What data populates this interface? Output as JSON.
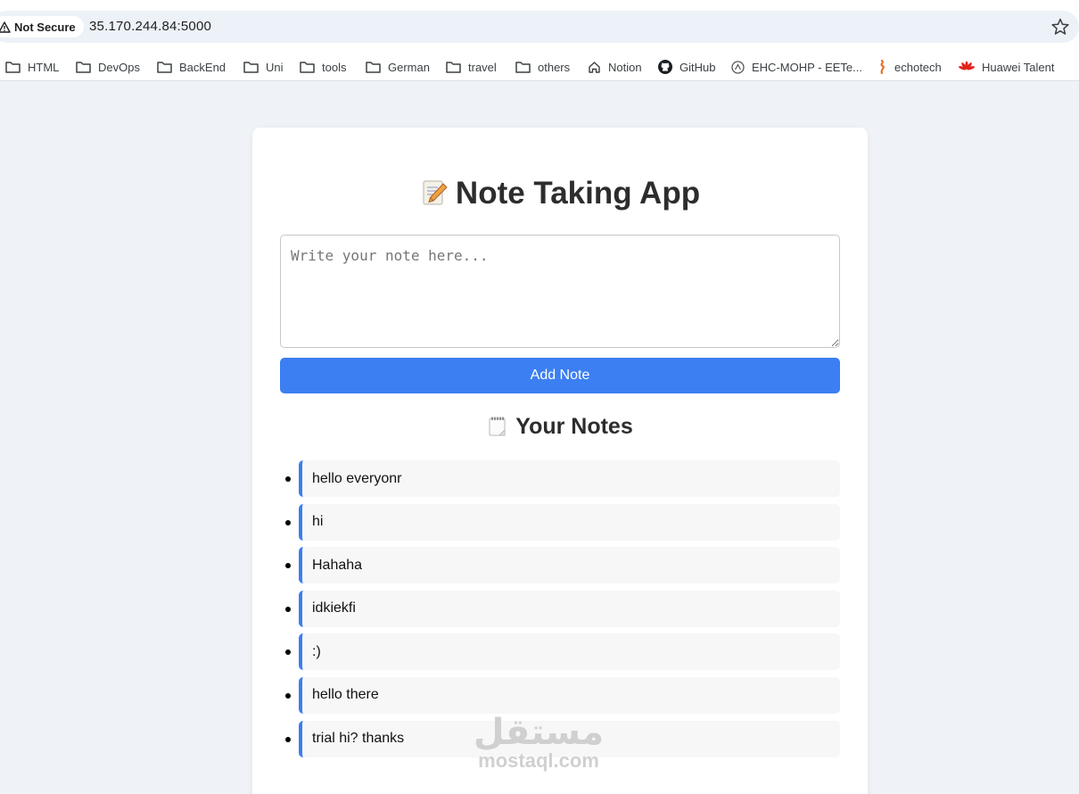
{
  "browser": {
    "security_label": "Not Secure",
    "url": "35.170.244.84:5000",
    "bookmarks": [
      {
        "label": "HTML",
        "icon": "folder-icon"
      },
      {
        "label": "DevOps",
        "icon": "folder-icon"
      },
      {
        "label": "BackEnd",
        "icon": "folder-icon"
      },
      {
        "label": "Uni",
        "icon": "folder-icon"
      },
      {
        "label": "tools",
        "icon": "folder-icon"
      },
      {
        "label": "German",
        "icon": "folder-icon"
      },
      {
        "label": "travel",
        "icon": "folder-icon"
      },
      {
        "label": "others",
        "icon": "folder-icon"
      },
      {
        "label": "Notion",
        "icon": "home-icon"
      },
      {
        "label": "GitHub",
        "icon": "github-icon"
      },
      {
        "label": "EHC-MOHP - EETe...",
        "icon": "ehc-icon"
      },
      {
        "label": "echotech",
        "icon": "echotech-icon"
      },
      {
        "label": "Huawei Talent",
        "icon": "huawei-icon"
      }
    ]
  },
  "app": {
    "title": "Note Taking App",
    "title_emoji": "memo-emoji",
    "input_placeholder": "Write your note here...",
    "add_button": "Add Note",
    "notes_heading": "Your Notes",
    "notes_emoji": "notepad-emoji",
    "notes": [
      "hello everyonr",
      "hi",
      "Hahaha",
      "idkiekfi",
      ":)",
      "hello there",
      "trial hi? thanks"
    ]
  },
  "watermark": {
    "arabic": "مستقل",
    "latin": "mostaql.com"
  },
  "colors": {
    "accent": "#3b7ff2",
    "page_bg": "#eff2f7",
    "note_bg": "#f7f7f7"
  }
}
